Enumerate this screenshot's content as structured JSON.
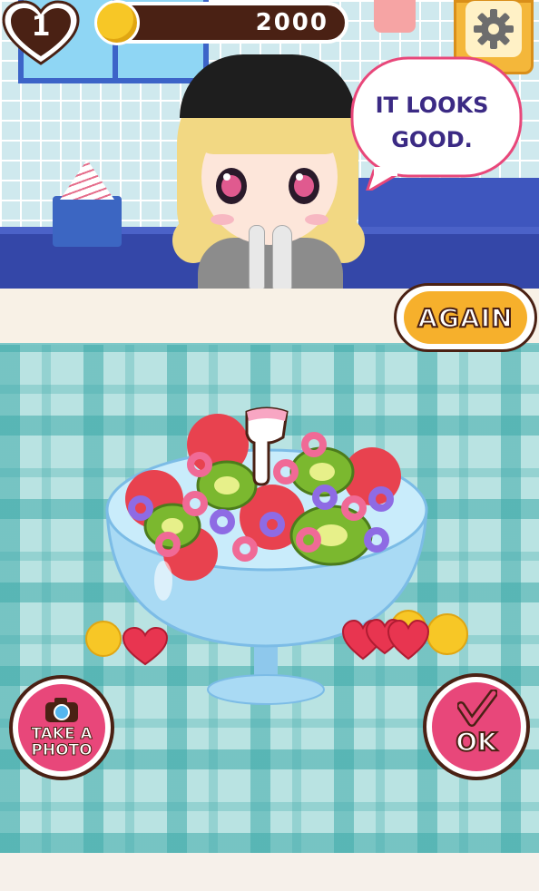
{
  "hud": {
    "lives": "1",
    "coins": "2000"
  },
  "dialogue": {
    "line1": "IT LOOKS",
    "line2": "GOOD."
  },
  "buttons": {
    "again": "AGAIN",
    "take_photo_line1": "TAKE A",
    "take_photo_line2": "PHOTO",
    "ok": "OK"
  },
  "icons": {
    "lives": "heart-icon",
    "coins": "coin-icon",
    "settings": "gear-icon",
    "camera": "camera-icon",
    "check": "checkmark-icon",
    "pointer": "pointing-hand-icon"
  },
  "colors": {
    "accent_pink": "#e8477a",
    "accent_orange": "#f6b02c",
    "dark_brown": "#4a2114",
    "bubble_text": "#3b2a84"
  }
}
